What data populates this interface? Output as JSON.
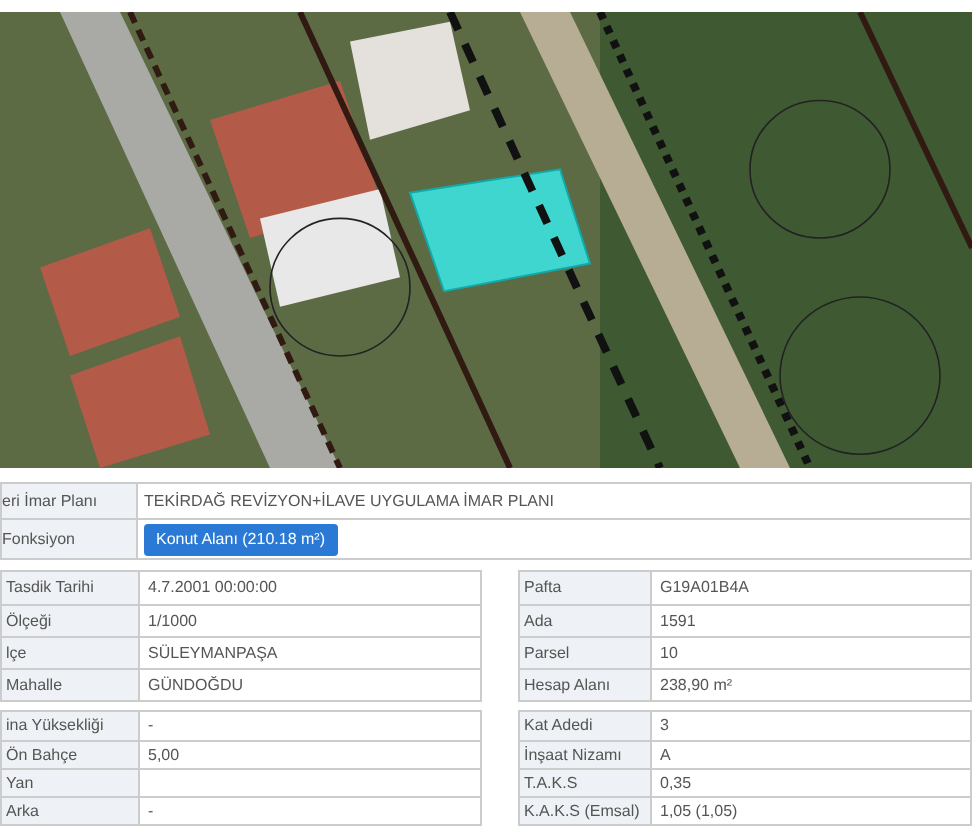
{
  "plan_table": [
    {
      "kind": "text",
      "label": "eri İmar Planı",
      "value": "TEKİRDAĞ REVİZYON+İLAVE UYGULAMA İMAR PLANI"
    },
    {
      "kind": "button",
      "label": "Fonksiyon",
      "value": "Konut Alanı (210.18 m²)"
    }
  ],
  "left_tables": [
    [
      {
        "label": "Tasdik Tarihi",
        "value": "4.7.2001 00:00:00"
      },
      {
        "label": "Ölçeği",
        "value": "1/1000"
      },
      {
        "label": "lçe",
        "value": "SÜLEYMANPAŞA"
      },
      {
        "label": "Mahalle",
        "value": "GÜNDOĞDU"
      }
    ],
    [
      {
        "label": "ina Yüksekliği",
        "value": "-"
      },
      {
        "label": "Ön Bahçe",
        "value": "5,00"
      },
      {
        "label": "Yan"
      },
      {
        "label": "Arka",
        "value": "-"
      }
    ]
  ],
  "right_tables": [
    [
      {
        "label": "Pafta",
        "value": "G19A01B4A"
      },
      {
        "label": "Ada",
        "value": "1591"
      },
      {
        "label": "Parsel",
        "value": "10"
      },
      {
        "label": "Hesap Alanı",
        "value": "238,90 m²"
      }
    ],
    [
      {
        "label": "Kat Adedi",
        "value": "3"
      },
      {
        "label": "İnşaat Nizamı",
        "value": "A"
      },
      {
        "label": "T.A.K.S",
        "value": "0,35"
      },
      {
        "label": "K.A.K.S (Emsal)",
        "value": "1,05 (1,05)"
      }
    ]
  ]
}
